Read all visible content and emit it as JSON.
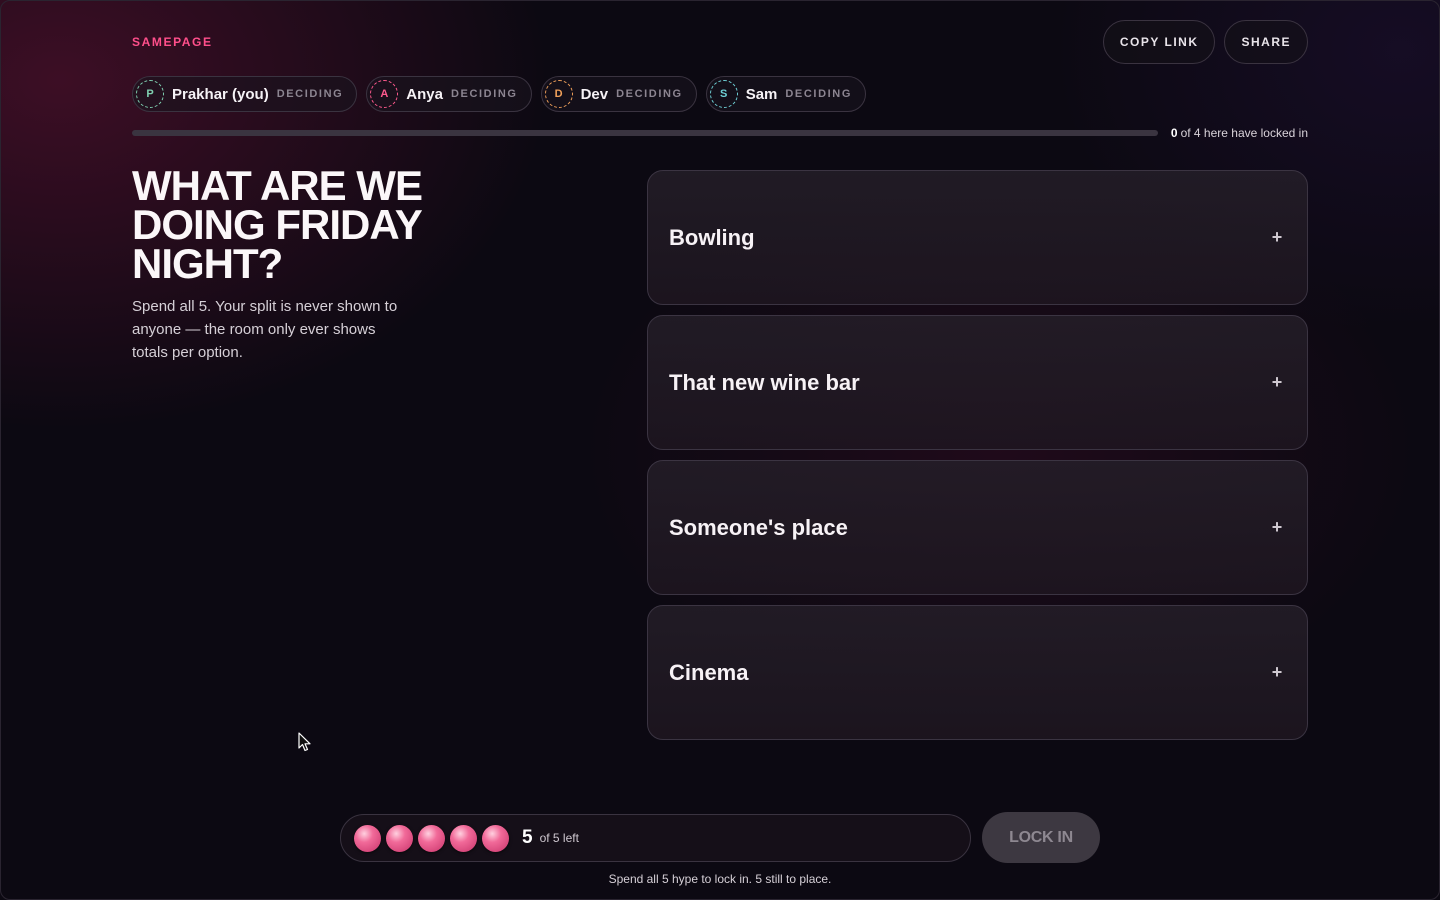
{
  "brand": "SAMEPAGE",
  "header": {
    "copy_link": "COPY LINK",
    "share": "SHARE"
  },
  "participants": [
    {
      "initial": "P",
      "name": "Prakhar (you)",
      "status": "DECIDING",
      "color": "#7fd0b0"
    },
    {
      "initial": "A",
      "name": "Anya",
      "status": "DECIDING",
      "color": "#ff5a8e"
    },
    {
      "initial": "D",
      "name": "Dev",
      "status": "DECIDING",
      "color": "#f0a05a"
    },
    {
      "initial": "S",
      "name": "Sam",
      "status": "DECIDING",
      "color": "#6fd1d6"
    }
  ],
  "progress": {
    "locked": "0",
    "text": "of 4 here have locked in",
    "fraction": 0
  },
  "question": "WHAT ARE WE DOING FRIDAY NIGHT?",
  "instructions": "Spend all 5. Your split is never shown to anyone — the room only ever shows totals per option.",
  "options": [
    {
      "label": "Bowling",
      "icon": "plus-icon"
    },
    {
      "label": "That new wine bar",
      "icon": "plus-icon"
    },
    {
      "label": "Someone's place",
      "icon": "plus-icon"
    },
    {
      "label": "Cinema",
      "icon": "plus-icon"
    }
  ],
  "hype": {
    "remaining": "5",
    "left_text": "of 5 left",
    "tokens": 5
  },
  "lock_in": "LOCK IN",
  "hint": "Spend all 5 hype to lock in. 5 still to place.",
  "colors": {
    "accent": "#ff4f8b",
    "background": "#0c0912"
  }
}
